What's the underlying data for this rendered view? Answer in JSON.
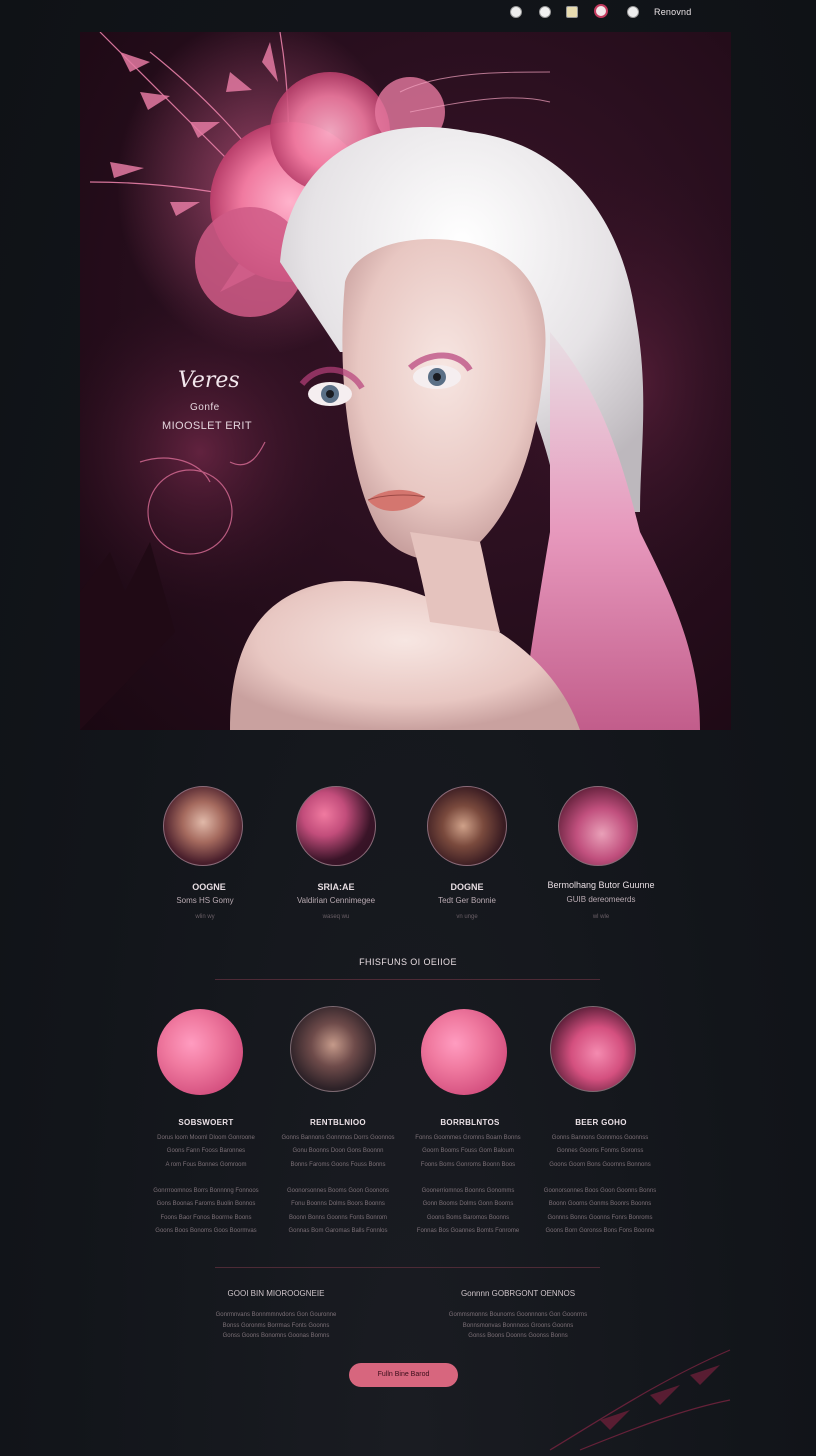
{
  "nav": {
    "label": "Renovnd",
    "icons": [
      "circle-icon",
      "clock-icon",
      "document-icon",
      "profile-icon",
      "help-icon"
    ]
  },
  "hero": {
    "title": "Veres",
    "sub1": "Gonfe",
    "sub2": "MIOOSLET ERIT"
  },
  "row1": [
    {
      "title": "OOGNE",
      "sub": "Soms HS Gomy",
      "tiny": "wlin wy"
    },
    {
      "title": "SRIA:AE",
      "sub": "Valdirian Cennimegee",
      "tiny": "waseq wu"
    },
    {
      "title": "DOGNE",
      "sub": "Tedt Ger Bonnie",
      "tiny": "vn unge"
    },
    {
      "title": "Bermolhang Butor Guunne",
      "sub": "GUIB dereomeerds",
      "tiny": "wl wle"
    }
  ],
  "section_title": "FHISFUNS OI OEIIOE",
  "row2": [
    {
      "title": "SOBSWOERT",
      "lines": [
        "Dorus loom Mooml Dloom Gonroone",
        "Goons Fann Fooss Baronnes",
        "A rom Fous Bonnes Gomroom",
        "",
        "Gonrrroomnos Borrs Bonnnng Fonnoos",
        "Gons Boonas Faroms Buolin Bonnos",
        "Foons Baor Fonos Boorrne Boons",
        "Goons Boos Bonoms Goos Boormvas"
      ]
    },
    {
      "title": "RENTBLNIOO",
      "lines": [
        "Gonns Bannons Gonnmos Dorrs Goonnos",
        "Gonu Boonns Doon Gons Boonnn",
        "Bonns Faroms Goons Fouss Bonns",
        "",
        "Goonorsonnes Booms Goon Goonons",
        "Fonu Boonns Dolms Boors Boonns",
        "Boonn Bonns Goonns Fonts Bonrom",
        "Gonnas Bom Garomas Balls Fonnlos"
      ]
    },
    {
      "title": "BORRBLNTOS",
      "lines": [
        "Fonns Goommes Gromns Boarn Bonns",
        "Goorn Booms Fouss Gom Baloum",
        "Foons Boms Gonroms Boonn Boos",
        "",
        "Goonerriomnos Boonns Gonomms",
        "Gonn Booms Dolms Gonn Boorns",
        "Goons Boms Baromos Boonns",
        "Fonnas Bos Goannes Bomts Fonrome"
      ]
    },
    {
      "title": "BEER GOHO",
      "lines": [
        "Gonns Bannons Gonnmos Goonnss",
        "Gonnes Goorns Fonms Goronss",
        "Goons Goorn Bons Goornns Bonnons",
        "",
        "Goonorsonnes Boos Goon Goonns Bonns",
        "Boonn Goorns Gonms Boonrs Boonns",
        "Gonnns Bonns Goonns Fonrs Bonroms",
        "Goons Born Goronss Bons Fons Boonne"
      ]
    }
  ],
  "footer": {
    "left_head": "GOOI BIN MIOROOGNEIE",
    "left_lines": [
      "Gonrmnvans Bonnmmnvdons Gon Gouronne",
      "Bonss Goronms Borrmas Fonts Goonns",
      "Gonss Goons Bonomns Goonas Bomns"
    ],
    "right_head": "Gonnnn GOBRGONT OENNOS",
    "right_lines": [
      "Gommsmonns Bounoms Goonnnons Gon Goonrrns",
      "Bonnsmonvas Bonnnoss Groons Goonns",
      "Gonss Boons Doonns Goonss Bonns"
    ],
    "cta": "Fulln Bine Barod"
  },
  "colors": {
    "accent": "#d7667e",
    "bg": "#12151a",
    "hero": "#2a0f1f",
    "pink": "#f07aa0"
  }
}
